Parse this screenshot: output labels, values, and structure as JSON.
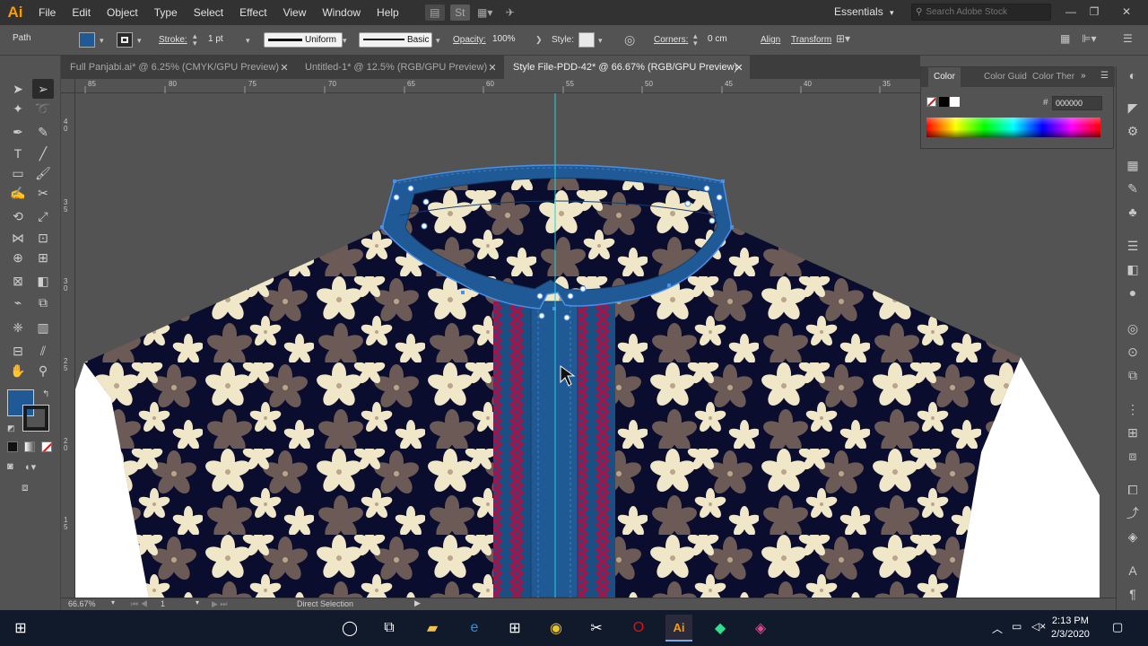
{
  "app": {
    "logo": "Ai",
    "menu": [
      "File",
      "Edit",
      "Object",
      "Type",
      "Select",
      "Effect",
      "View",
      "Window",
      "Help"
    ],
    "workspace": "Essentials",
    "stock_search_placeholder": "Search Adobe Stock"
  },
  "control_bar": {
    "object_type": "Path",
    "fill_color": "#1f5a96",
    "stroke_label": "Stroke:",
    "stroke_weight": "1 pt",
    "stroke_profile": "Uniform",
    "brush": "Basic",
    "opacity_label": "Opacity:",
    "opacity_value": "100%",
    "style_label": "Style:",
    "corners_label": "Corners:",
    "corners_value": "0 cm",
    "align_label": "Align",
    "transform_label": "Transform"
  },
  "tabs": [
    {
      "label": "Full Panjabi.ai* @ 6.25% (CMYK/GPU Preview)",
      "active": false
    },
    {
      "label": "Untitled-1* @ 12.5% (RGB/GPU Preview)",
      "active": false
    },
    {
      "label": "Style File-PDD-42* @ 66.67% (RGB/GPU Preview)",
      "active": true
    }
  ],
  "ruler": {
    "h_ticks": [
      "85",
      "80",
      "75",
      "70",
      "65",
      "60",
      "55",
      "50",
      "45",
      "40",
      "35"
    ],
    "v_ticks": [
      "4\n0",
      "3\n5",
      "3\n0",
      "2\n5",
      "2\n0",
      "1\n5"
    ]
  },
  "color_panel": {
    "tabs": [
      "Color",
      "Color Guid",
      "Color Ther"
    ],
    "hex_label": "#",
    "hex_value": "000000"
  },
  "status_bar": {
    "zoom": "66.67%",
    "artboard": "1",
    "tool": "Direct Selection"
  },
  "clock": {
    "time": "2:13 PM",
    "date": "2/3/2020"
  },
  "colors": {
    "accent": "#ff9a00",
    "collar_fill": "#1f5a96",
    "fabric_base": "#0a0d2e",
    "flower_light": "#f0e6c8",
    "flower_dark": "#6b5a55",
    "placket_trim": "#a0164a",
    "selection": "#4a8fe8"
  }
}
